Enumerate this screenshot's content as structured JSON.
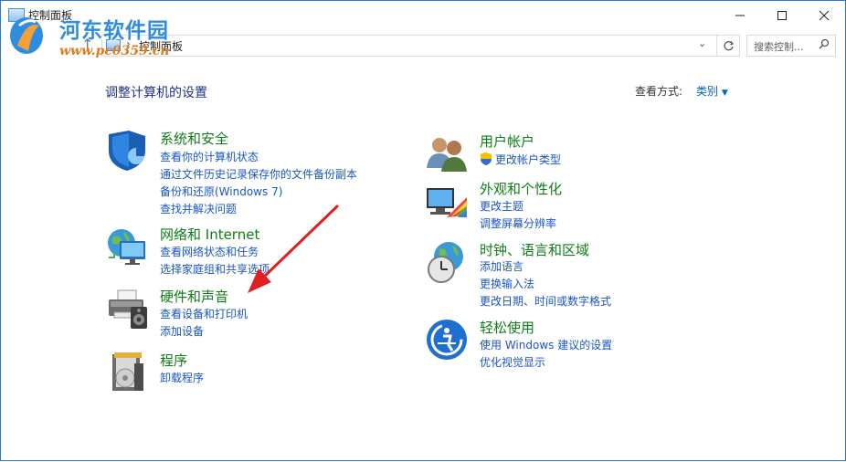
{
  "window": {
    "title": "控制面板"
  },
  "watermark": {
    "site": "河东软件园",
    "url": "www.pc0359.cn"
  },
  "address": {
    "path": "控制面板",
    "separator": "›"
  },
  "search": {
    "placeholder": "搜索控制..."
  },
  "header": {
    "title": "调整计算机的设置",
    "view_label": "查看方式:",
    "view_value": "类别"
  },
  "left": [
    {
      "title": "系统和安全",
      "links": [
        "查看你的计算机状态",
        "通过文件历史记录保存你的文件备份副本",
        "备份和还原(Windows 7)",
        "查找并解决问题"
      ]
    },
    {
      "title": "网络和 Internet",
      "links": [
        "查看网络状态和任务",
        "选择家庭组和共享选项"
      ]
    },
    {
      "title": "硬件和声音",
      "links": [
        "查看设备和打印机",
        "添加设备"
      ]
    },
    {
      "title": "程序",
      "links": [
        "卸载程序"
      ]
    }
  ],
  "right": [
    {
      "title": "用户帐户",
      "links": [
        "更改帐户类型"
      ]
    },
    {
      "title": "外观和个性化",
      "links": [
        "更改主题",
        "调整屏幕分辨率"
      ]
    },
    {
      "title": "时钟、语言和区域",
      "links": [
        "添加语言",
        "更换输入法",
        "更改日期、时间或数字格式"
      ]
    },
    {
      "title": "轻松使用",
      "links": [
        "使用 Windows 建议的设置",
        "优化视觉显示"
      ]
    }
  ],
  "colors": {
    "title_green": "#0f7d17",
    "link_blue": "#1a56c4",
    "arrow_red": "#e02020"
  }
}
